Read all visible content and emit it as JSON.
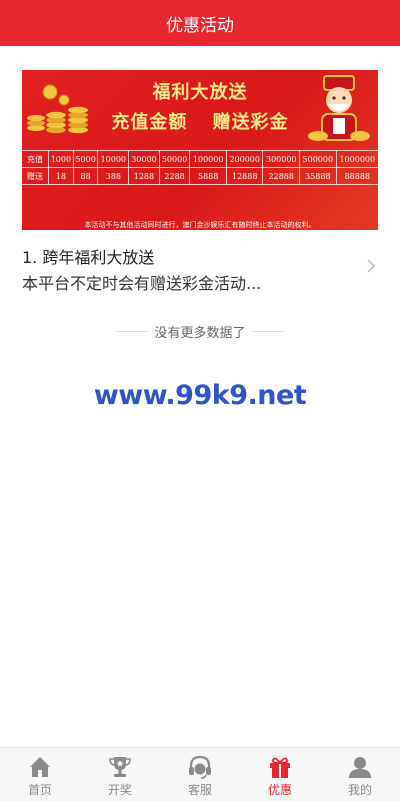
{
  "header": {
    "title": "优惠活动"
  },
  "banner": {
    "title": "福利大放送",
    "sub_left": "充值金额",
    "sub_right": "赠送彩金",
    "row_labels": [
      "充值",
      "赠送"
    ],
    "recharge": [
      "1000",
      "5000",
      "10000",
      "30000",
      "50000",
      "100000",
      "200000",
      "300000",
      "500000",
      "1000000"
    ],
    "bonus": [
      "18",
      "88",
      "388",
      "1288",
      "2288",
      "5888",
      "12888",
      "22888",
      "35888",
      "88888"
    ],
    "notice": "本活动不与其他活动同时进行，澳门金沙娱乐汇有随时终止本活动的权利。",
    "colors": {
      "background": "#e3201f",
      "gold_text": "#ffe98a"
    }
  },
  "promo": {
    "title": "1. 跨年福利大放送",
    "description": "本平台不定时会有赠送彩金活动..."
  },
  "list_end": {
    "text": "没有更多数据了"
  },
  "watermark": {
    "text": "www.99k9.net",
    "color": "#2d55c7"
  },
  "tabbar": {
    "active_color": "#e8262d",
    "items": [
      {
        "label": "首页",
        "icon": "home-icon",
        "active": false
      },
      {
        "label": "开奖",
        "icon": "trophy-icon",
        "active": false
      },
      {
        "label": "客服",
        "icon": "headset-icon",
        "active": false
      },
      {
        "label": "优惠",
        "icon": "gift-icon",
        "active": true
      },
      {
        "label": "我的",
        "icon": "user-icon",
        "active": false
      }
    ]
  }
}
